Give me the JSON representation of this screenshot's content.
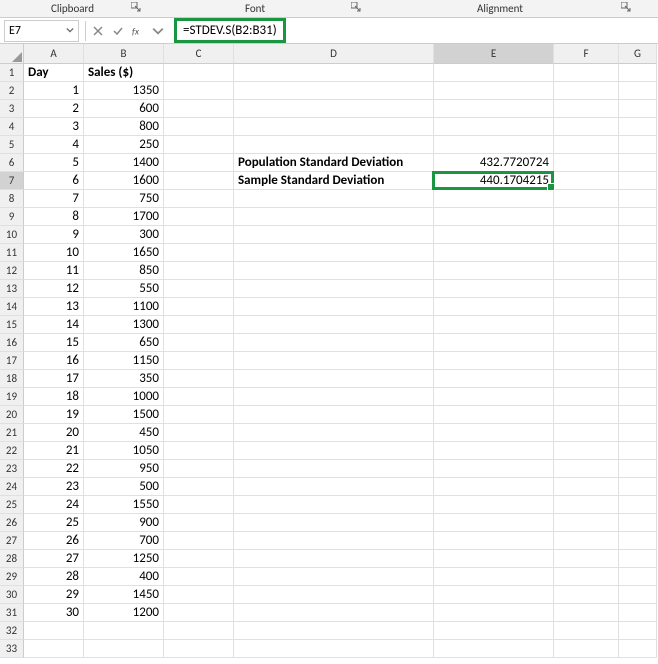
{
  "ribbon": {
    "group_clipboard": "Clipboard",
    "group_font": "Font",
    "group_alignment": "Alignment"
  },
  "formula_bar": {
    "name_box": "E7",
    "formula": "=STDEV.S(B2:B31)"
  },
  "columns": [
    "A",
    "B",
    "C",
    "D",
    "E",
    "F",
    "G"
  ],
  "headers": {
    "day": "Day",
    "sales": "Sales ($)"
  },
  "labels": {
    "pop_std": "Population Standard Deviation",
    "samp_std": "Sample Standard Deviation"
  },
  "results": {
    "pop_std": "432.7720724",
    "samp_std": "440.1704215"
  },
  "rows": [
    {
      "day": 1,
      "sales": 1350
    },
    {
      "day": 2,
      "sales": 600
    },
    {
      "day": 3,
      "sales": 800
    },
    {
      "day": 4,
      "sales": 250
    },
    {
      "day": 5,
      "sales": 1400
    },
    {
      "day": 6,
      "sales": 1600
    },
    {
      "day": 7,
      "sales": 750
    },
    {
      "day": 8,
      "sales": 1700
    },
    {
      "day": 9,
      "sales": 300
    },
    {
      "day": 10,
      "sales": 1650
    },
    {
      "day": 11,
      "sales": 850
    },
    {
      "day": 12,
      "sales": 550
    },
    {
      "day": 13,
      "sales": 1100
    },
    {
      "day": 14,
      "sales": 1300
    },
    {
      "day": 15,
      "sales": 650
    },
    {
      "day": 16,
      "sales": 1150
    },
    {
      "day": 17,
      "sales": 350
    },
    {
      "day": 18,
      "sales": 1000
    },
    {
      "day": 19,
      "sales": 1500
    },
    {
      "day": 20,
      "sales": 450
    },
    {
      "day": 21,
      "sales": 1050
    },
    {
      "day": 22,
      "sales": 950
    },
    {
      "day": 23,
      "sales": 500
    },
    {
      "day": 24,
      "sales": 1550
    },
    {
      "day": 25,
      "sales": 900
    },
    {
      "day": 26,
      "sales": 700
    },
    {
      "day": 27,
      "sales": 1250
    },
    {
      "day": 28,
      "sales": 400
    },
    {
      "day": 29,
      "sales": 1450
    },
    {
      "day": 30,
      "sales": 1200
    }
  ],
  "selected_cell": "E7",
  "chart_data": {
    "type": "table",
    "title": "Sales data with standard deviation",
    "columns": [
      "Day",
      "Sales ($)"
    ],
    "data": [
      [
        1,
        1350
      ],
      [
        2,
        600
      ],
      [
        3,
        800
      ],
      [
        4,
        250
      ],
      [
        5,
        1400
      ],
      [
        6,
        1600
      ],
      [
        7,
        750
      ],
      [
        8,
        1700
      ],
      [
        9,
        300
      ],
      [
        10,
        1650
      ],
      [
        11,
        850
      ],
      [
        12,
        550
      ],
      [
        13,
        1100
      ],
      [
        14,
        1300
      ],
      [
        15,
        650
      ],
      [
        16,
        1150
      ],
      [
        17,
        350
      ],
      [
        18,
        1000
      ],
      [
        19,
        1500
      ],
      [
        20,
        450
      ],
      [
        21,
        1050
      ],
      [
        22,
        950
      ],
      [
        23,
        500
      ],
      [
        24,
        1550
      ],
      [
        25,
        900
      ],
      [
        26,
        700
      ],
      [
        27,
        1250
      ],
      [
        28,
        400
      ],
      [
        29,
        1450
      ],
      [
        30,
        1200
      ]
    ],
    "summary": {
      "Population Standard Deviation": 432.7720724,
      "Sample Standard Deviation": 440.1704215
    }
  }
}
